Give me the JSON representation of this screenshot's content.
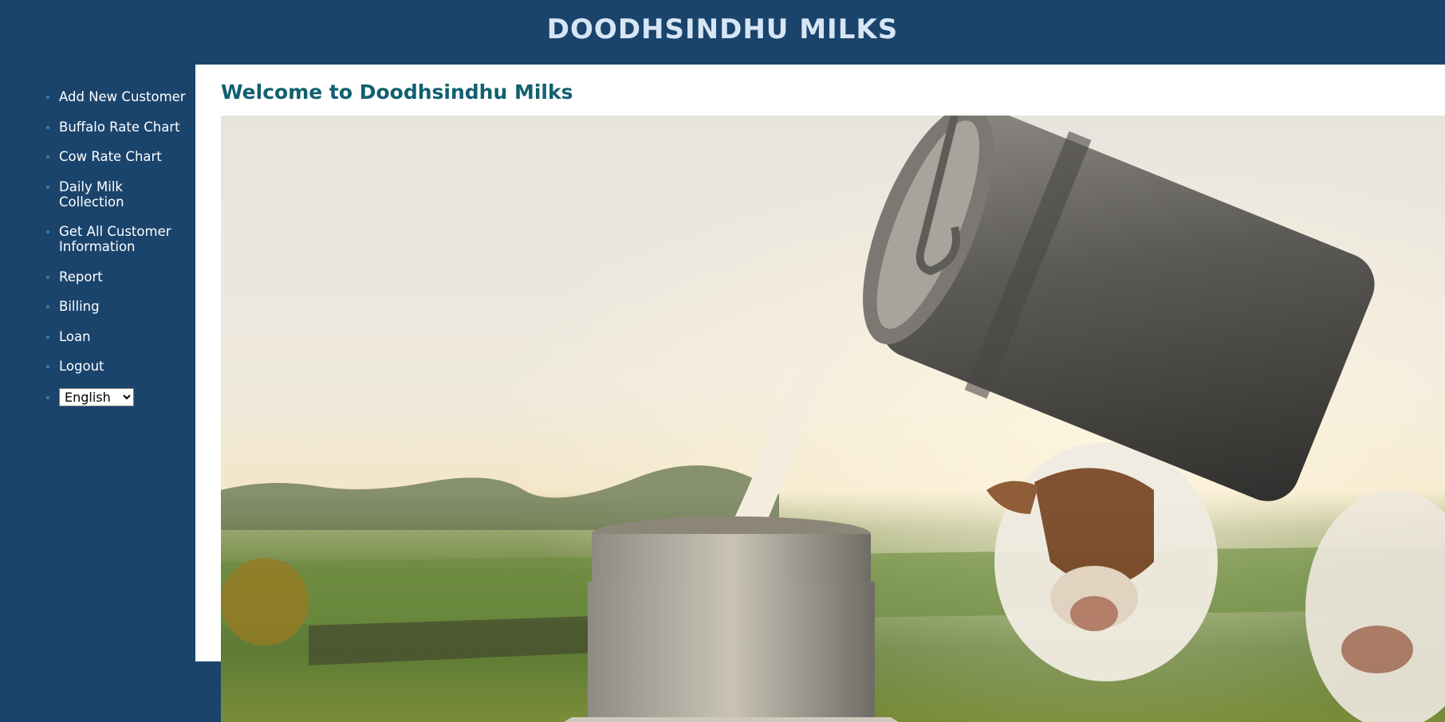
{
  "header": {
    "title": "DOODHSINDHU MILKS"
  },
  "sidebar": {
    "items": [
      {
        "label": "Add New Customer"
      },
      {
        "label": "Buffalo Rate Chart"
      },
      {
        "label": "Cow Rate Chart"
      },
      {
        "label": "Daily Milk Collection"
      },
      {
        "label": "Get All Customer Information"
      },
      {
        "label": "Report"
      },
      {
        "label": "Billing"
      },
      {
        "label": "Loan"
      },
      {
        "label": "Logout"
      }
    ],
    "language": {
      "selected": "English"
    }
  },
  "main": {
    "heading": "Welcome to Doodhsindhu Milks"
  },
  "colors": {
    "background": "#1b446c",
    "heading": "#11606f",
    "title": "#d6e6f5"
  }
}
